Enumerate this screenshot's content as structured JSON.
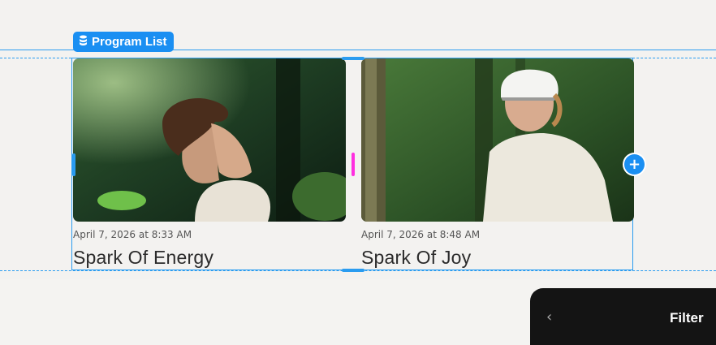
{
  "component_tag": {
    "label": "Program List",
    "icon": "database-icon"
  },
  "cards": [
    {
      "date": "April 7, 2026 at 8:33 AM",
      "title": "Spark Of Energy",
      "image": "man-in-forest-photo"
    },
    {
      "date": "April 7, 2026 at 8:48 AM",
      "title": "Spark Of Joy",
      "image": "cyclist-in-forest-photo"
    }
  ],
  "add_button": {
    "icon": "plus-icon"
  },
  "filter_panel": {
    "back_icon": "chevron-left-icon",
    "label": "Filter"
  },
  "colors": {
    "accent": "#1a8ff2",
    "gap_marker": "#ff2fe0",
    "panel": "#141414"
  }
}
